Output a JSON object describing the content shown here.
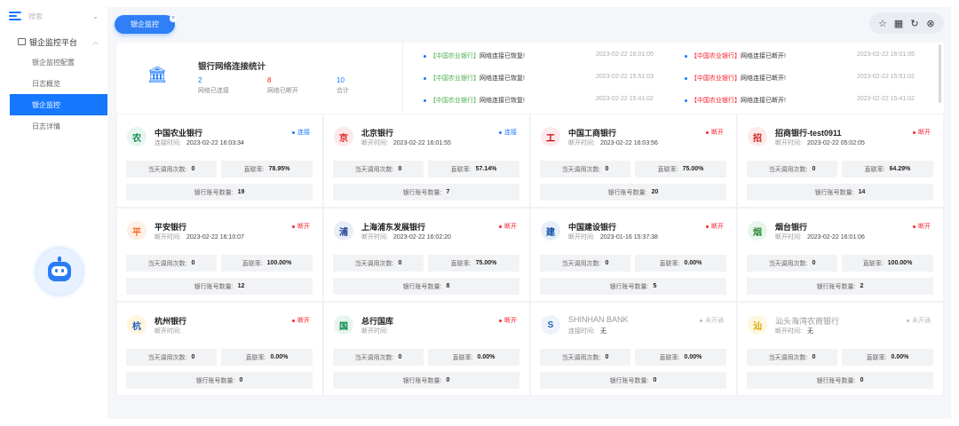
{
  "sidebar": {
    "search_placeholder": "搜索",
    "group_label": "银企监控平台",
    "items": [
      {
        "label": "银企监控配置",
        "active": false
      },
      {
        "label": "日志概览",
        "active": false
      },
      {
        "label": "银企监控",
        "active": true
      },
      {
        "label": "日志详情",
        "active": false
      }
    ]
  },
  "tab": {
    "label": "银企监控"
  },
  "stats": {
    "title": "银行网络连接统计",
    "connected_value": "2",
    "connected_label": "网络已连接",
    "disconnected_value": "8",
    "disconnected_label": "网络已断开",
    "total_value": "10",
    "total_label": "合计"
  },
  "events": [
    {
      "bank": "【中国农业银行】",
      "text": "网络连接已恢复!",
      "time": "2023-02-22 16:01:05",
      "type": "ok"
    },
    {
      "bank": "【中国农业银行】",
      "text": "网络连接已断开!",
      "time": "2023-02-22 16:01:05",
      "type": "bad"
    },
    {
      "bank": "【中国农业银行】",
      "text": "网络连接已恢复!",
      "time": "2023-02-22 15:51:03",
      "type": "ok"
    },
    {
      "bank": "【中国农业银行】",
      "text": "网络连接已断开!",
      "time": "2023-02-22 15:51:02",
      "type": "bad"
    },
    {
      "bank": "【中国农业银行】",
      "text": "网络连接已恢复!",
      "time": "2023-02-22 15:41:02",
      "type": "ok"
    },
    {
      "bank": "【中国农业银行】",
      "text": "网络连接已断开!",
      "time": "2023-02-22 15:41:02",
      "type": "bad"
    }
  ],
  "cards": [
    {
      "name": "中国农业银行",
      "time_label": "连接时间:",
      "time": "2023-02-22 16:03:34",
      "status": "连接",
      "state": "on",
      "calls_label": "当天调用次数:",
      "calls": "0",
      "rate_label": "直联率:",
      "rate": "78.95%",
      "acct_label": "银行账号数量:",
      "acct": "19",
      "logo": "农",
      "logo_color": "#0b8a4a",
      "logo_bg": "#e6f6ee"
    },
    {
      "name": "北京银行",
      "time_label": "断开时间:",
      "time": "2023-02-22 16:01:55",
      "status": "连接",
      "state": "on",
      "calls_label": "当天调用次数:",
      "calls": "0",
      "rate_label": "直联率:",
      "rate": "57.14%",
      "acct_label": "银行账号数量:",
      "acct": "7",
      "logo": "京",
      "logo_color": "#e0282e",
      "logo_bg": "#fde9ea"
    },
    {
      "name": "中国工商银行",
      "time_label": "断开时间:",
      "time": "2023-02-22 16:03:56",
      "status": "断开",
      "state": "off",
      "calls_label": "当天调用次数:",
      "calls": "0",
      "rate_label": "直联率:",
      "rate": "75.00%",
      "acct_label": "银行账号数量:",
      "acct": "20",
      "logo": "工",
      "logo_color": "#c7000b",
      "logo_bg": "#fdeaea"
    },
    {
      "name": "招商银行-test0911",
      "time_label": "断开时间:",
      "time": "2023-02-22 05:02:05",
      "status": "断开",
      "state": "off",
      "calls_label": "当天调用次数:",
      "calls": "0",
      "rate_label": "直联率:",
      "rate": "64.29%",
      "acct_label": "银行账号数量:",
      "acct": "14",
      "logo": "招",
      "logo_color": "#d21f1f",
      "logo_bg": "#fdeaea"
    },
    {
      "name": "平安银行",
      "time_label": "断开时间:",
      "time": "2023-02-22 16:10:07",
      "status": "断开",
      "state": "off",
      "calls_label": "当天调用次数:",
      "calls": "0",
      "rate_label": "直联率:",
      "rate": "100.00%",
      "acct_label": "银行账号数量:",
      "acct": "12",
      "logo": "平",
      "logo_color": "#f26b1d",
      "logo_bg": "#fff0e6"
    },
    {
      "name": "上海浦东发展银行",
      "time_label": "断开时间:",
      "time": "2023-02-22 16:02:20",
      "status": "断开",
      "state": "off",
      "calls_label": "当天调用次数:",
      "calls": "0",
      "rate_label": "直联率:",
      "rate": "75.00%",
      "acct_label": "银行账号数量:",
      "acct": "8",
      "logo": "浦",
      "logo_color": "#1d3c8f",
      "logo_bg": "#e8edf8"
    },
    {
      "name": "中国建设银行",
      "time_label": "断开时间:",
      "time": "2023-01-16 15:37:38",
      "status": "断开",
      "state": "off",
      "calls_label": "当天调用次数:",
      "calls": "0",
      "rate_label": "直联率:",
      "rate": "0.00%",
      "acct_label": "银行账号数量:",
      "acct": "5",
      "logo": "建",
      "logo_color": "#0a4ea3",
      "logo_bg": "#e6eef9"
    },
    {
      "name": "烟台银行",
      "time_label": "断开时间:",
      "time": "2023-02-22 16:01:06",
      "status": "断开",
      "state": "off",
      "calls_label": "当天调用次数:",
      "calls": "0",
      "rate_label": "直联率:",
      "rate": "100.00%",
      "acct_label": "银行账号数量:",
      "acct": "2",
      "logo": "烟",
      "logo_color": "#2e8b3e",
      "logo_bg": "#e8f5eb"
    },
    {
      "name": "杭州银行",
      "time_label": "断开时间:",
      "time": "",
      "status": "断开",
      "state": "off",
      "calls_label": "当天调用次数:",
      "calls": "0",
      "rate_label": "直联率:",
      "rate": "0.00%",
      "acct_label": "银行账号数量:",
      "acct": "0",
      "logo": "杭",
      "logo_color": "#1f5fbf",
      "logo_bg": "#fff6dd"
    },
    {
      "name": "总行国库",
      "time_label": "断开时间:",
      "time": "",
      "status": "断开",
      "state": "off",
      "calls_label": "当天调用次数:",
      "calls": "0",
      "rate_label": "直联率:",
      "rate": "0.00%",
      "acct_label": "银行账号数量:",
      "acct": "0",
      "logo": "国",
      "logo_color": "#0b8a4a",
      "logo_bg": "#e6f6ee"
    },
    {
      "name": "SHINHAN BANK",
      "time_label": "连接时间:",
      "time": "无",
      "status": "未开通",
      "state": "na",
      "calls_label": "当天调用次数:",
      "calls": "0",
      "rate_label": "直联率:",
      "rate": "0.00%",
      "acct_label": "银行账号数量:",
      "acct": "0",
      "logo": "S",
      "logo_color": "#2a5cb8",
      "logo_bg": "#edf2fb"
    },
    {
      "name": "汕头海湾农商银行",
      "time_label": "断开时间:",
      "time": "无",
      "status": "未开通",
      "state": "na",
      "calls_label": "当天调用次数:",
      "calls": "0",
      "rate_label": "直联率:",
      "rate": "0.00%",
      "acct_label": "银行账号数量:",
      "acct": "0",
      "logo": "汕",
      "logo_color": "#d9a400",
      "logo_bg": "#fff8e0"
    }
  ]
}
